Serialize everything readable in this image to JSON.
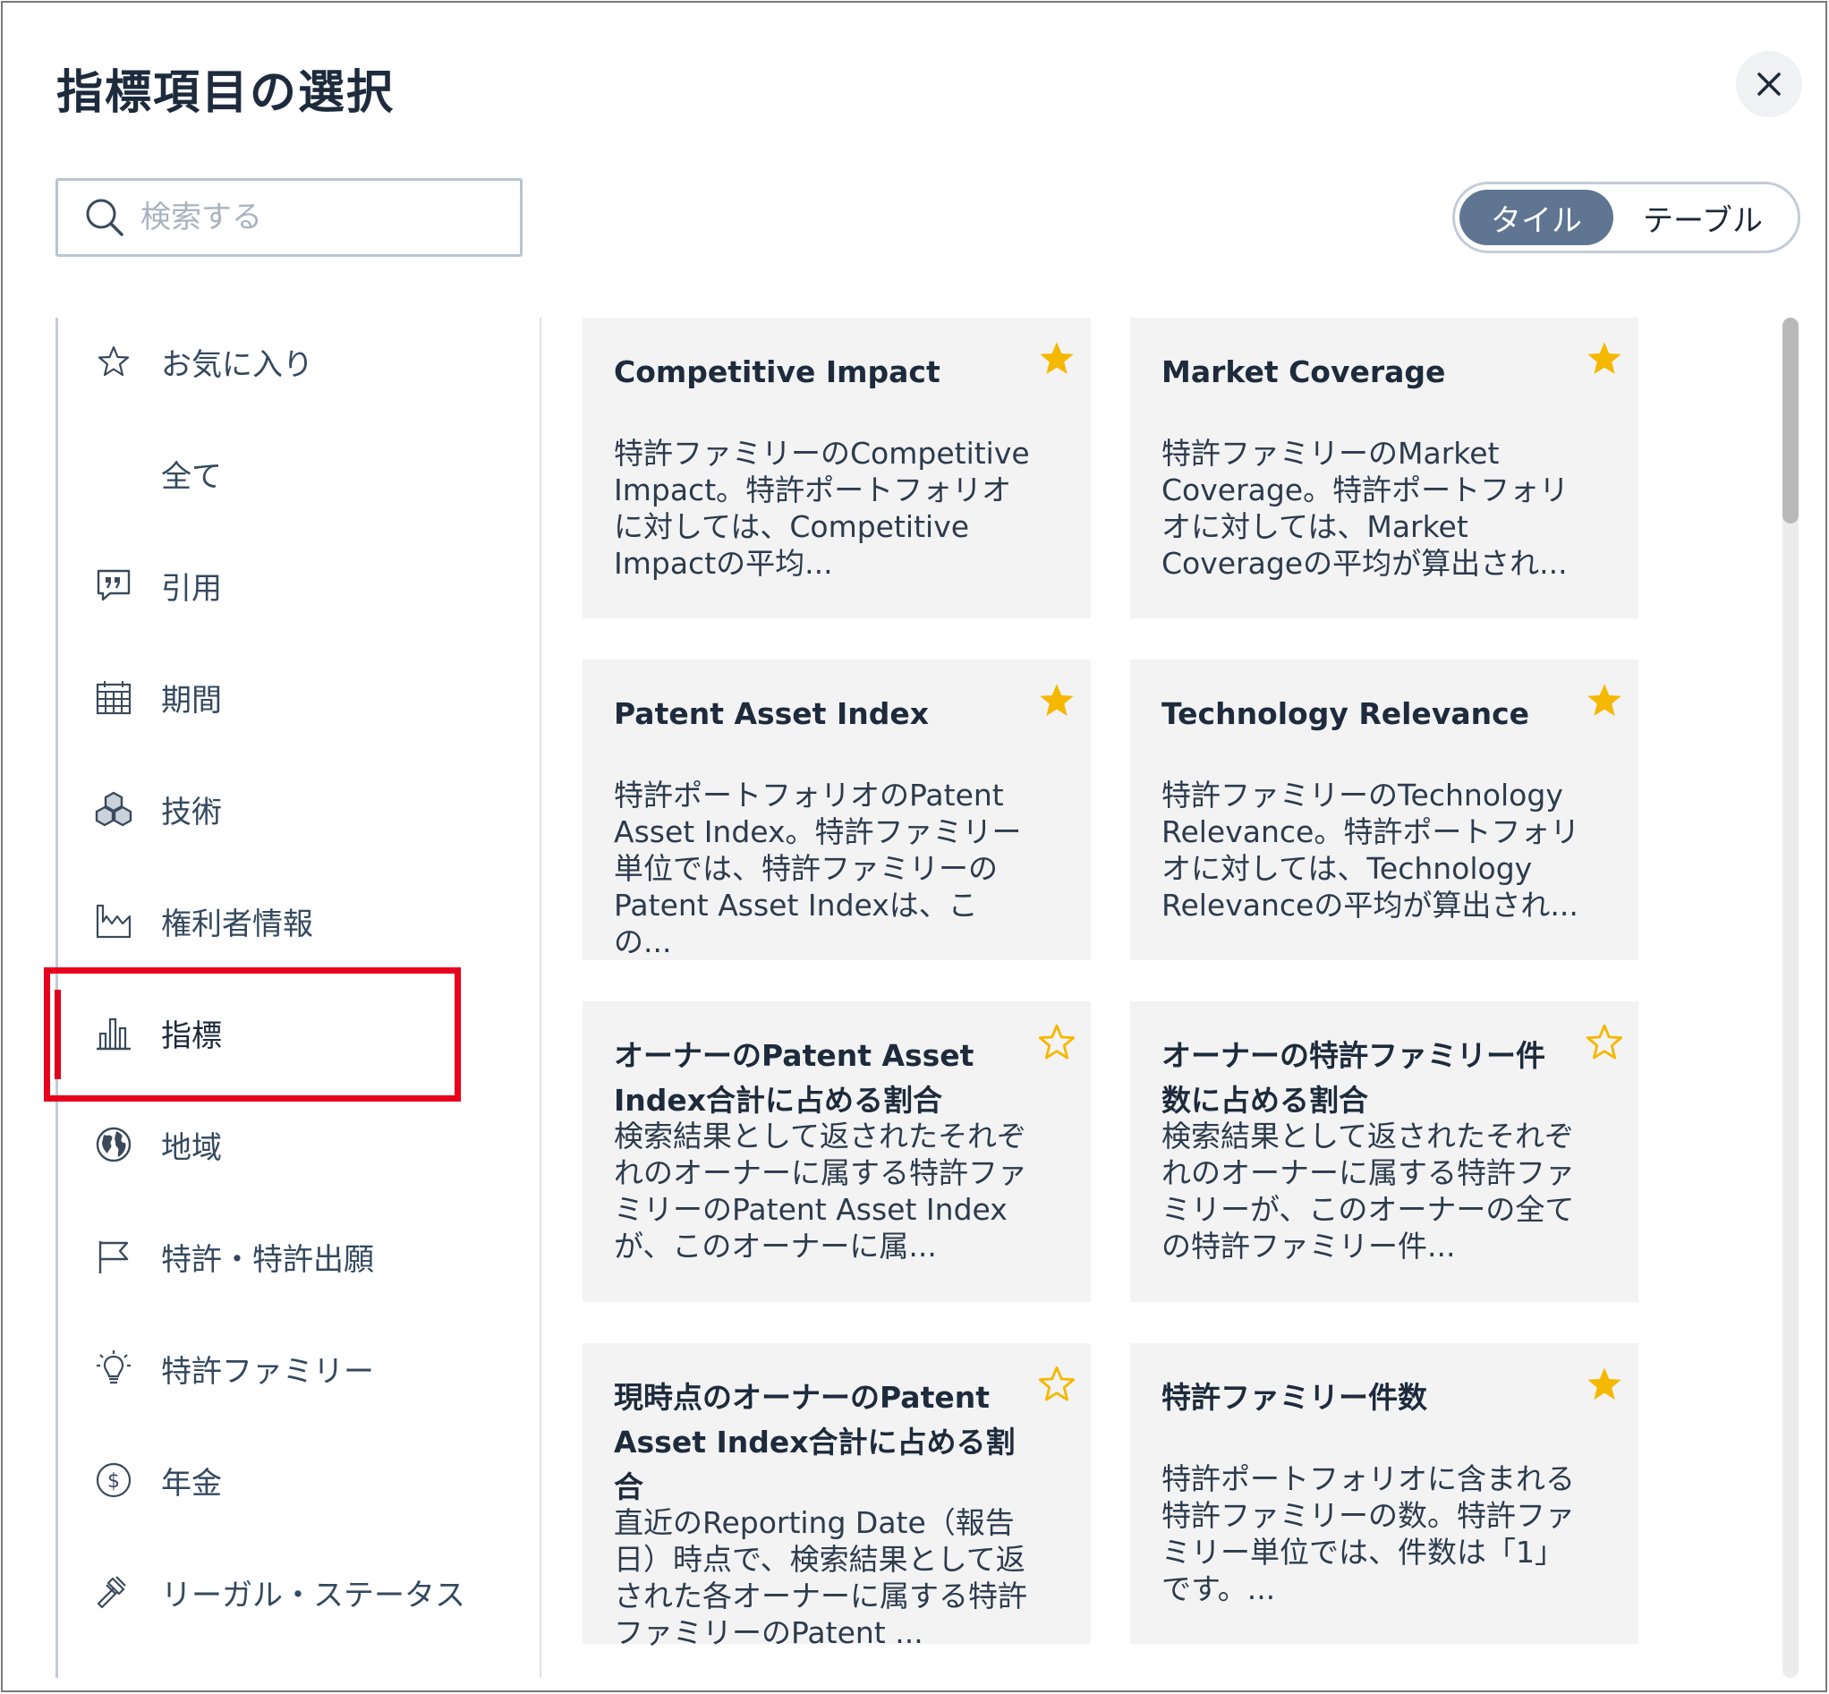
{
  "dialog": {
    "title": "指標項目の選択"
  },
  "search": {
    "placeholder": "検索する"
  },
  "view_toggle": {
    "tile_label": "タイル",
    "table_label": "テーブル",
    "selected": "タイル"
  },
  "sidebar": {
    "active": "指標",
    "items": [
      {
        "label": "お気に入り",
        "icon": "star-outline-icon"
      },
      {
        "label": "全て",
        "icon": ""
      },
      {
        "label": "引用",
        "icon": "quote-icon"
      },
      {
        "label": "期間",
        "icon": "calendar-icon"
      },
      {
        "label": "技術",
        "icon": "cubes-icon"
      },
      {
        "label": "権利者情報",
        "icon": "factory-icon"
      },
      {
        "label": "指標",
        "icon": "bar-chart-icon"
      },
      {
        "label": "地域",
        "icon": "globe-icon"
      },
      {
        "label": "特許・特許出願",
        "icon": "flag-icon"
      },
      {
        "label": "特許ファミリー",
        "icon": "lightbulb-icon"
      },
      {
        "label": "年金",
        "icon": "dollar-circle-icon"
      },
      {
        "label": "リーガル・ステータス",
        "icon": "gavel-icon"
      }
    ]
  },
  "cards": [
    {
      "title": "Competitive Impact",
      "desc": "特許ファミリーのCompetitive Impact。特許ポートフォリオに対しては、Competitive Impactの平均...",
      "favorite": true
    },
    {
      "title": "Market Coverage",
      "desc": "特許ファミリーのMarket Coverage。特許ポートフォリオに対しては、Market Coverageの平均が算出され...",
      "favorite": true
    },
    {
      "title": "Patent Asset Index",
      "desc": "特許ポートフォリオのPatent Asset Index。特許ファミリー単位では、特許ファミリーのPatent Asset Indexは、この...",
      "favorite": true
    },
    {
      "title": "Technology Relevance",
      "desc": "特許ファミリーのTechnology Relevance。特許ポートフォリオに対しては、Technology Relevanceの平均が算出され...",
      "favorite": true
    },
    {
      "title": "オーナーのPatent Asset Index合計に占める割合",
      "desc": "検索結果として返されたそれぞれのオーナーに属する特許ファミリーのPatent Asset Indexが、このオーナーに属...",
      "favorite": false
    },
    {
      "title": "オーナーの特許ファミリー件数に占める割合",
      "desc": "検索結果として返されたそれぞれのオーナーに属する特許ファミリーが、このオーナーの全ての特許ファミリー件...",
      "favorite": false
    },
    {
      "title": "現時点のオーナーのPatent Asset Index合計に占める割合",
      "desc": "直近のReporting Date（報告日）時点で、検索結果として返された各オーナーに属する特許ファミリーのPatent ...",
      "favorite": false
    },
    {
      "title": "特許ファミリー件数",
      "desc": "特許ポートフォリオに含まれる特許ファミリーの数。特許ファミリー単位では、件数は「1」です。...",
      "favorite": true
    }
  ],
  "colors": {
    "star_filled": "#f5b800",
    "active_marker": "#e0001b",
    "toggle_active": "#5f7591"
  }
}
